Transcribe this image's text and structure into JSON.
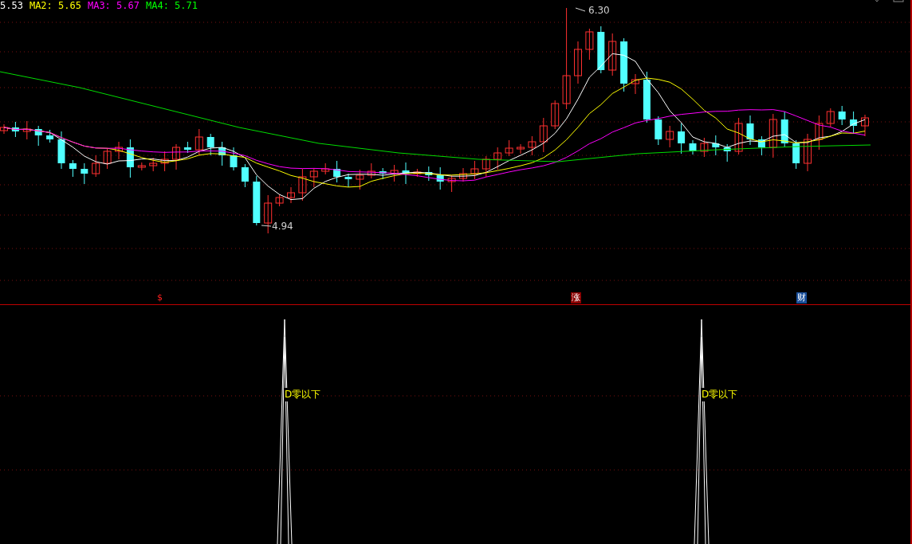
{
  "legend": [
    {
      "label": "5.53",
      "color": "#ffffff"
    },
    {
      "label": "MA2: 5.65",
      "color": "#ffff00"
    },
    {
      "label": "MA3: 5.67",
      "color": "#ff00ff"
    },
    {
      "label": "MA4: 5.71",
      "color": "#00ff00"
    }
  ],
  "annotations": [
    {
      "text": "6.30",
      "kind": "high"
    },
    {
      "text": "4.94",
      "kind": "low"
    }
  ],
  "signals": [
    {
      "text": "$",
      "kind": "dollar"
    },
    {
      "text": "涨",
      "kind": "rise"
    },
    {
      "text": "财",
      "kind": "wealth"
    }
  ],
  "indicator": {
    "labels": [
      "D零以下",
      "D零以下"
    ]
  }
}
